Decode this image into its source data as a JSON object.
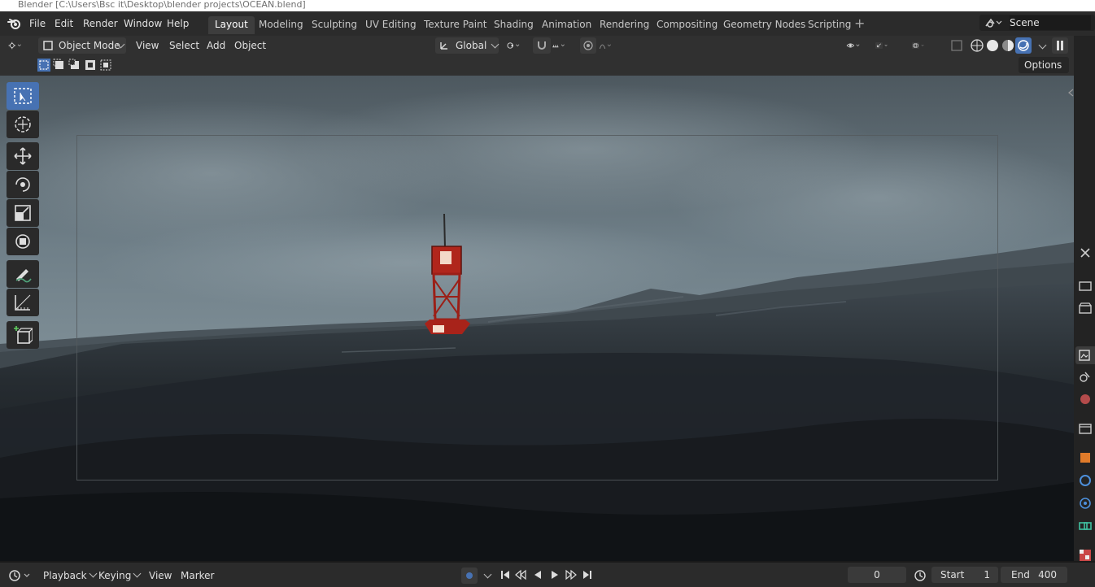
{
  "window": {
    "title": "Blender [C:\\Users\\Bsc it\\Desktop\\blender projects\\OCEAN.blend]"
  },
  "menu": [
    "File",
    "Edit",
    "Render",
    "Window",
    "Help"
  ],
  "workspaces": [
    "Layout",
    "Modeling",
    "Sculpting",
    "UV Editing",
    "Texture Paint",
    "Shading",
    "Animation",
    "Rendering",
    "Compositing",
    "Geometry Nodes",
    "Scripting"
  ],
  "active_workspace": "Layout",
  "scene": {
    "name": "Scene"
  },
  "viewport_header": {
    "mode": "Object Mode",
    "view": "View",
    "select": "Select",
    "add": "Add",
    "object": "Object",
    "orientation": "Global"
  },
  "tool_settings": {
    "options": "Options"
  },
  "tools": [
    "select-box",
    "cursor",
    "move",
    "rotate",
    "scale",
    "transform",
    "annotate",
    "measure",
    "add-cube"
  ],
  "timeline": {
    "playback": "Playback",
    "keying": "Keying",
    "view": "View",
    "marker": "Marker",
    "current_frame": "0",
    "start_label": "Start",
    "start_value": "1",
    "end_label": "End",
    "end_value": "400"
  },
  "colors": {
    "accent": "#4772b3",
    "buoy_red": "#c3241a",
    "sky": "#7c8d96",
    "sea": "#2f363c"
  }
}
